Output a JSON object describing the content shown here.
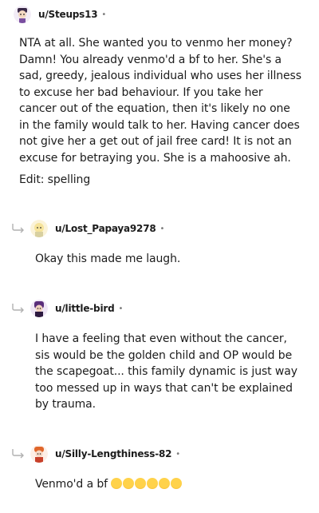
{
  "comments": [
    {
      "username": "u/Steups13",
      "paragraphs": [
        "NTA at all. She wanted you to venmo her money? Damn! You already venmo'd a bf to her. She's a sad, greedy, jealous individual who uses her illness to excuse her bad behaviour. If you take her cancer out of the equation, then it's likely no one in the family would talk to her. Having cancer does not give her a get out of jail free card! It is not an excuse for betraying you. She is a mahoosive ah.",
        "Edit: spelling"
      ]
    },
    {
      "username": "u/Lost_Papaya9278",
      "body": "Okay this made me laugh."
    },
    {
      "username": "u/little-bird",
      "body": "I have a feeling that even without the cancer, sis would be the golden child and OP would be the scapegoat... this family dynamic is just way too messed up in ways that can't be explained by trauma."
    },
    {
      "username": "u/Silly-Lengthiness-82",
      "body": "Venmo'd a bf",
      "emojis": [
        "face-with-tears-of-joy-emoji",
        "face-with-tears-of-joy-emoji",
        "face-with-tears-of-joy-emoji",
        "rolling-on-floor-laughing-emoji",
        "rolling-on-floor-laughing-emoji",
        "rolling-on-floor-laughing-emoji"
      ]
    }
  ],
  "separator": "•"
}
